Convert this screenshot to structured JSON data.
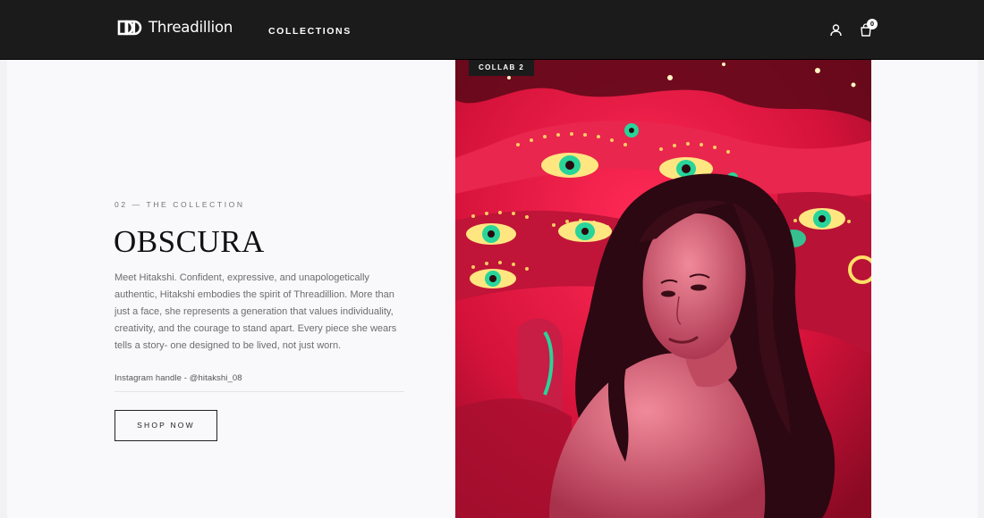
{
  "header": {
    "brand": "Threadillion",
    "nav": [
      {
        "label": "COLLECTIONS"
      }
    ],
    "cart_count": "0",
    "icons": {
      "account": "user-icon",
      "cart": "shopping-bag-icon"
    }
  },
  "feature": {
    "badge": "COLLAB 2",
    "eyebrow": "02 — THE COLLECTION",
    "title": "OBSCURA",
    "description": "Meet Hitakshi. Confident, expressive, and unapologetically authentic, Hitakshi embodies the spirit of Threadillion. More than just a face, she represents a generation that values individuality, creativity, and the courage to stand apart. Every piece she wears tells a story- one designed to be lived, not just worn.",
    "instagram": "Instagram handle - @hitakshi_08",
    "cta": "SHOP NOW"
  },
  "colors": {
    "header_bg": "#1b1b1c",
    "page_bg": "#f9f8fb",
    "photo_accent": "#e0143c"
  }
}
